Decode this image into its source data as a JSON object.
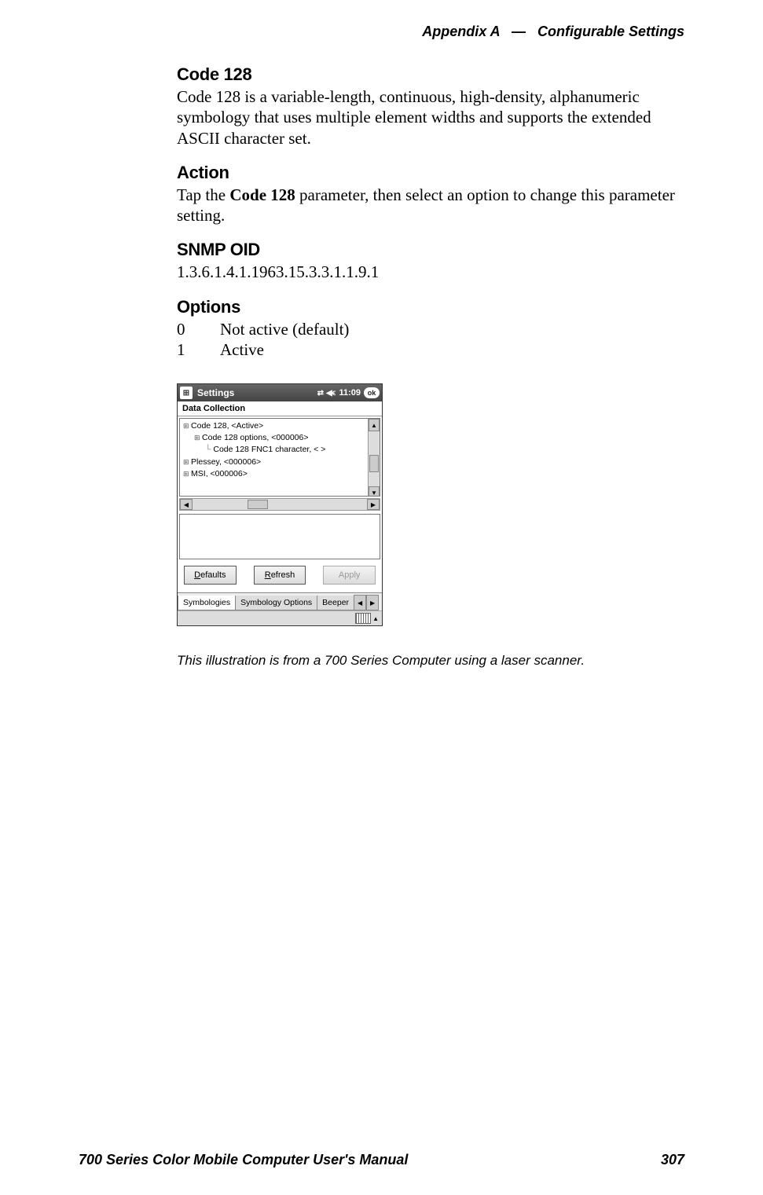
{
  "header": {
    "appendix": "Appendix A",
    "separator": "—",
    "section": "Configurable Settings"
  },
  "sections": {
    "title": "Code 128",
    "intro": "Code 128 is a variable-length, continuous, high-density, alphanumeric symbology that uses multiple element widths and supports the extended ASCII character set.",
    "action_heading": "Action",
    "action_text_pre": "Tap the ",
    "action_text_bold": "Code 128",
    "action_text_post": " parameter, then select an option to change this parameter setting.",
    "snmp_heading": "SNMP OID",
    "snmp_value": "1.3.6.1.4.1.1963.15.3.3.1.1.9.1",
    "options_heading": "Options",
    "options": [
      {
        "key": "0",
        "label": "Not active (default)"
      },
      {
        "key": "1",
        "label": "Active"
      }
    ]
  },
  "screenshot": {
    "titlebar": {
      "app": "Settings",
      "clock": "11:09",
      "ok": "ok"
    },
    "subheader": "Data Collection",
    "tree": {
      "items": [
        "Code 128, <Active>",
        "Code 128 options, <000006>",
        "Code 128 FNC1 character, < >",
        "Plessey, <000006>",
        "MSI, <000006>"
      ]
    },
    "buttons": {
      "defaults": "Defaults",
      "refresh": "Refresh",
      "apply": "Apply"
    },
    "tabs": {
      "t1": "Symbologies",
      "t2": "Symbology Options",
      "t3": "Beeper"
    }
  },
  "caption": "This illustration is  from a 700 Series Computer using a laser scanner.",
  "footer": {
    "manual": "700 Series Color Mobile Computer User's Manual",
    "page": "307"
  }
}
